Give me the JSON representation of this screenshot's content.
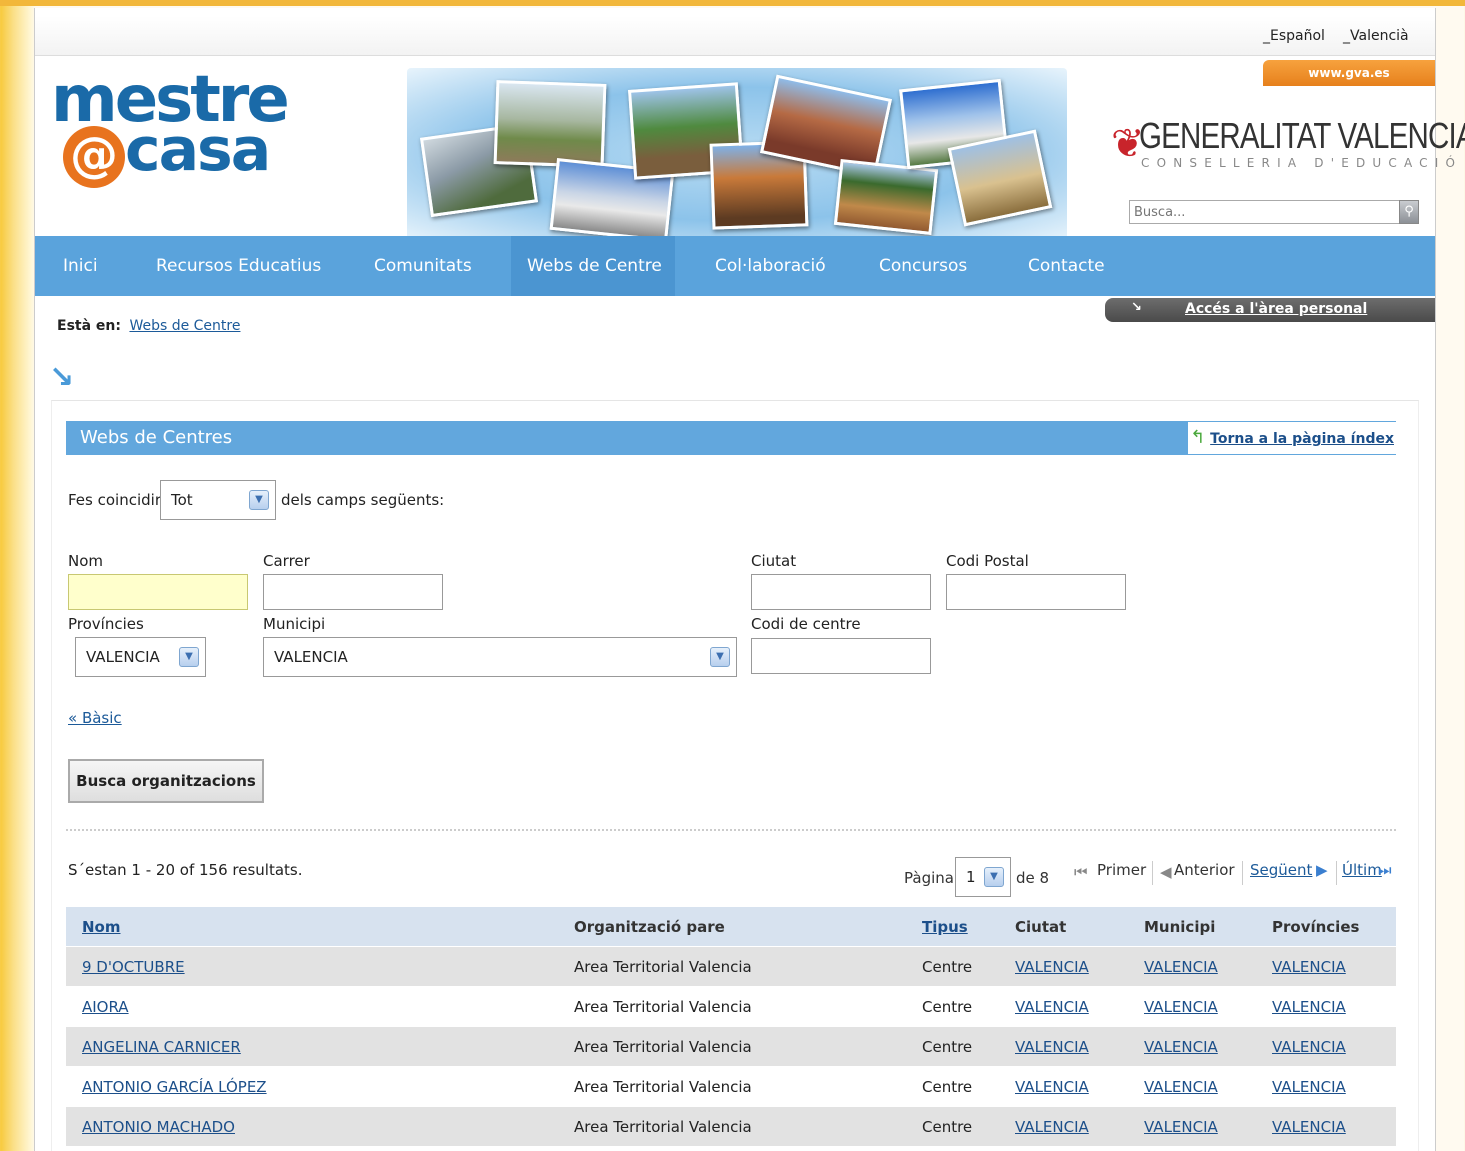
{
  "languages": [
    "_Español",
    "_Valencià"
  ],
  "logo": {
    "line1": "mestre",
    "at": "@",
    "line2": "casa"
  },
  "gva_tab": "www.gva.es",
  "generalitat": {
    "title": "GENERALITAT VALENCIANA",
    "subtitle": "CONSELLERIA D'EDUCACIÓ"
  },
  "search": {
    "placeholder": "Busca..."
  },
  "nav": [
    "Inici",
    "Recursos Educatius",
    "Comunitats",
    "Webs de Centre",
    "Col·laboració",
    "Concursos",
    "Contacte"
  ],
  "nav_active": "Webs de Centre",
  "personal_area": "Accés a l'àrea personal",
  "breadcrumb": {
    "label": "Està en:",
    "link": "Webs de Centre"
  },
  "panel": {
    "title": "Webs de Centres",
    "back_link": "Torna a la pàgina índex",
    "match_prefix": "Fes coincidir",
    "match_value": "Tot",
    "match_suffix": "dels camps següents:",
    "fields": {
      "nom": "Nom",
      "carrer": "Carrer",
      "ciutat": "Ciutat",
      "codi_postal": "Codi Postal",
      "provincies": "Províncies",
      "municipi": "Municipi",
      "codi_centre": "Codi de centre"
    },
    "provincia_value": "VALENCIA",
    "municipi_value": "VALENCIA",
    "basic_link": "« Bàsic",
    "search_button": "Busca organitzacions"
  },
  "results": {
    "summary": "S´estan 1 - 20 of 156 resultats.",
    "page_label": "Pàgina",
    "page_value": "1",
    "of_label": "de 8",
    "first": "Primer",
    "prev": "Anterior",
    "next": "Següent",
    "last": "Últim"
  },
  "table": {
    "headers": [
      "Nom",
      "Organització pare",
      "Tipus",
      "Ciutat",
      "Municipi",
      "Províncies"
    ],
    "rows": [
      [
        "9 D'OCTUBRE",
        "Area Territorial Valencia",
        "Centre",
        "VALENCIA",
        "VALENCIA",
        "VALENCIA"
      ],
      [
        "AIORA",
        "Area Territorial Valencia",
        "Centre",
        "VALENCIA",
        "VALENCIA",
        "VALENCIA"
      ],
      [
        "ANGELINA CARNICER",
        "Area Territorial Valencia",
        "Centre",
        "VALENCIA",
        "VALENCIA",
        "VALENCIA"
      ],
      [
        "ANTONIO GARCÍA LÓPEZ",
        "Area Territorial Valencia",
        "Centre",
        "VALENCIA",
        "VALENCIA",
        "VALENCIA"
      ],
      [
        "ANTONIO MACHADO",
        "Area Territorial Valencia",
        "Centre",
        "VALENCIA",
        "VALENCIA",
        "VALENCIA"
      ]
    ]
  }
}
